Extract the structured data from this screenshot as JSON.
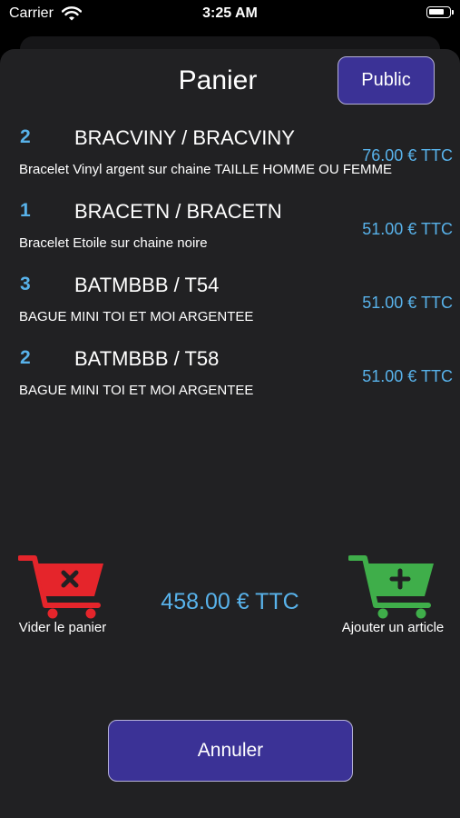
{
  "status_bar": {
    "carrier": "Carrier",
    "time": "3:25 AM"
  },
  "header": {
    "title": "Panier",
    "public_label": "Public"
  },
  "items": [
    {
      "qty": "2",
      "ref": "BRACVINY / BRACVINY",
      "price": "76.00 € TTC",
      "description": "Bracelet Vinyl argent sur chaine TAILLE HOMME OU FEMME"
    },
    {
      "qty": "1",
      "ref": "BRACETN / BRACETN",
      "price": "51.00 € TTC",
      "description": "Bracelet Etoile sur chaine noire"
    },
    {
      "qty": "3",
      "ref": "BATMBBB / T54",
      "price": "51.00 € TTC",
      "description": "BAGUE MINI TOI ET MOI ARGENTEE"
    },
    {
      "qty": "2",
      "ref": "BATMBBB / T58",
      "price": "51.00 € TTC",
      "description": "BAGUE MINI TOI ET MOI ARGENTEE"
    }
  ],
  "footer": {
    "clear_label": "Vider le panier",
    "total": "458.00 € TTC",
    "add_label": "Ajouter un article",
    "cancel_label": "Annuler"
  },
  "colors": {
    "accent": "#58b2ea",
    "button": "#3b3296",
    "clear_cart": "#e5252b",
    "add_cart": "#3fae4a",
    "sheet": "#212123"
  },
  "icons": {
    "clear": "cart-remove-icon",
    "add": "cart-add-icon"
  }
}
